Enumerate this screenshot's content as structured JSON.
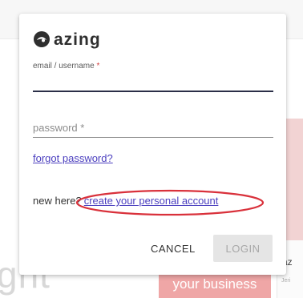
{
  "background": {
    "big_text": "ght",
    "pink_button_label": "your business",
    "card_logo": "az",
    "card_sub": "Jeri"
  },
  "logo": {
    "text": "azing",
    "icon": "azing-logo-icon"
  },
  "form": {
    "email_label": "email / username",
    "required_mark": "*",
    "email_value": "",
    "password_placeholder": "password *",
    "password_value": "",
    "forgot_link": "forgot password?",
    "new_here_text": "new here?",
    "create_account_link": "create your personal account"
  },
  "actions": {
    "cancel_label": "CANCEL",
    "login_label": "LOGIN",
    "login_enabled": false
  },
  "colors": {
    "link": "#4b3fbf",
    "annotation": "#d9313b",
    "underline_active": "#2b2f48",
    "pink": "#efa6a6"
  }
}
